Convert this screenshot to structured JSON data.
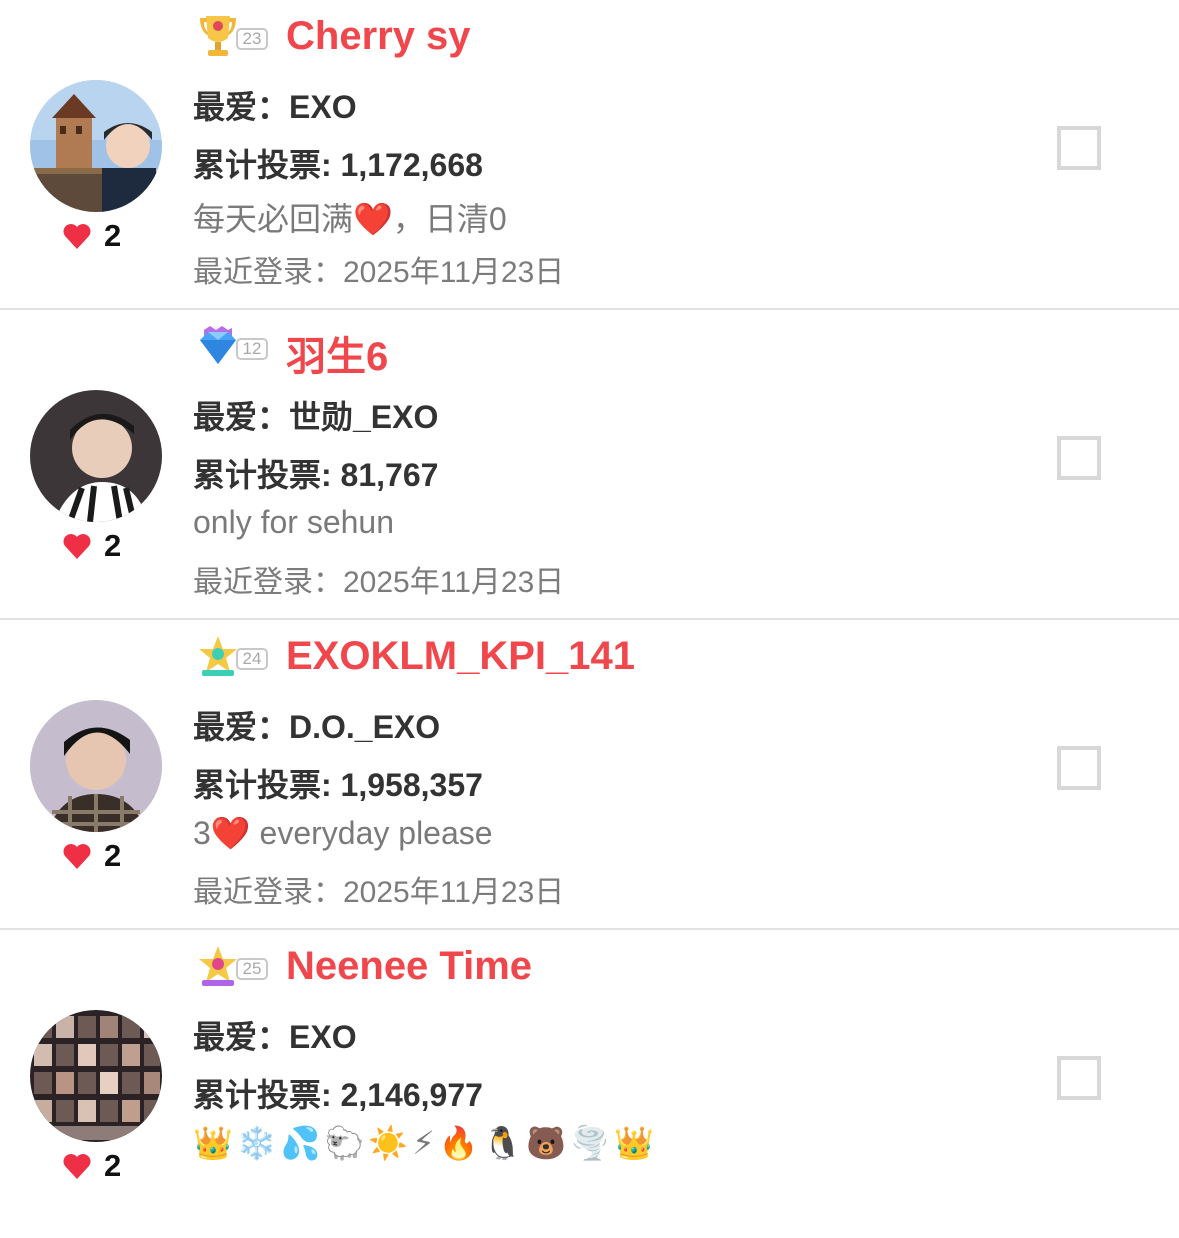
{
  "users": [
    {
      "name": "Cherry sy",
      "level": "23",
      "favorite": "最爱：EXO",
      "votes": "累计投票: 1,172,668",
      "bio": "每天必回满❤️，日清0",
      "last_login": "最近登录：2025年11月23日",
      "likes": "2",
      "badge": "trophy",
      "badge_color": "#f2b63a",
      "avatar": "tower-photo"
    },
    {
      "name": "羽生6",
      "level": "12",
      "favorite": "最爱：世勋_EXO",
      "votes": "累计投票: 81,767",
      "bio": "only for sehun",
      "last_login": "最近登录：2025年11月23日",
      "likes": "2",
      "badge": "diamond",
      "badge_color": "#4aa4f5",
      "avatar": "portrait-dark"
    },
    {
      "name": "EXOKLM_KPI_141",
      "level": "24",
      "favorite": "最爱：D.O._EXO",
      "votes": "累计投票: 1,958,357",
      "bio": "3❤️ everyday please",
      "last_login": "最近登录：2025年11月23日",
      "likes": "2",
      "badge": "star-teal",
      "badge_color": "#3ccfb6",
      "avatar": "portrait-plaid"
    },
    {
      "name": "Neenee Time",
      "level": "25",
      "favorite": "最爱：EXO",
      "votes": "累计投票: 2,146,977",
      "bio_emojis": [
        "👑",
        "❄️",
        "💦",
        "🐑",
        "☀️",
        "⚡",
        "🔥",
        "🐧",
        "🐻",
        "🌪️",
        "👑"
      ],
      "likes": "2",
      "badge": "star-purple",
      "badge_color": "#b065e8",
      "avatar": "collage"
    }
  ],
  "colors": {
    "name": "#f0474d",
    "heart": "#ef2f45",
    "divider": "#e2e2e2"
  }
}
